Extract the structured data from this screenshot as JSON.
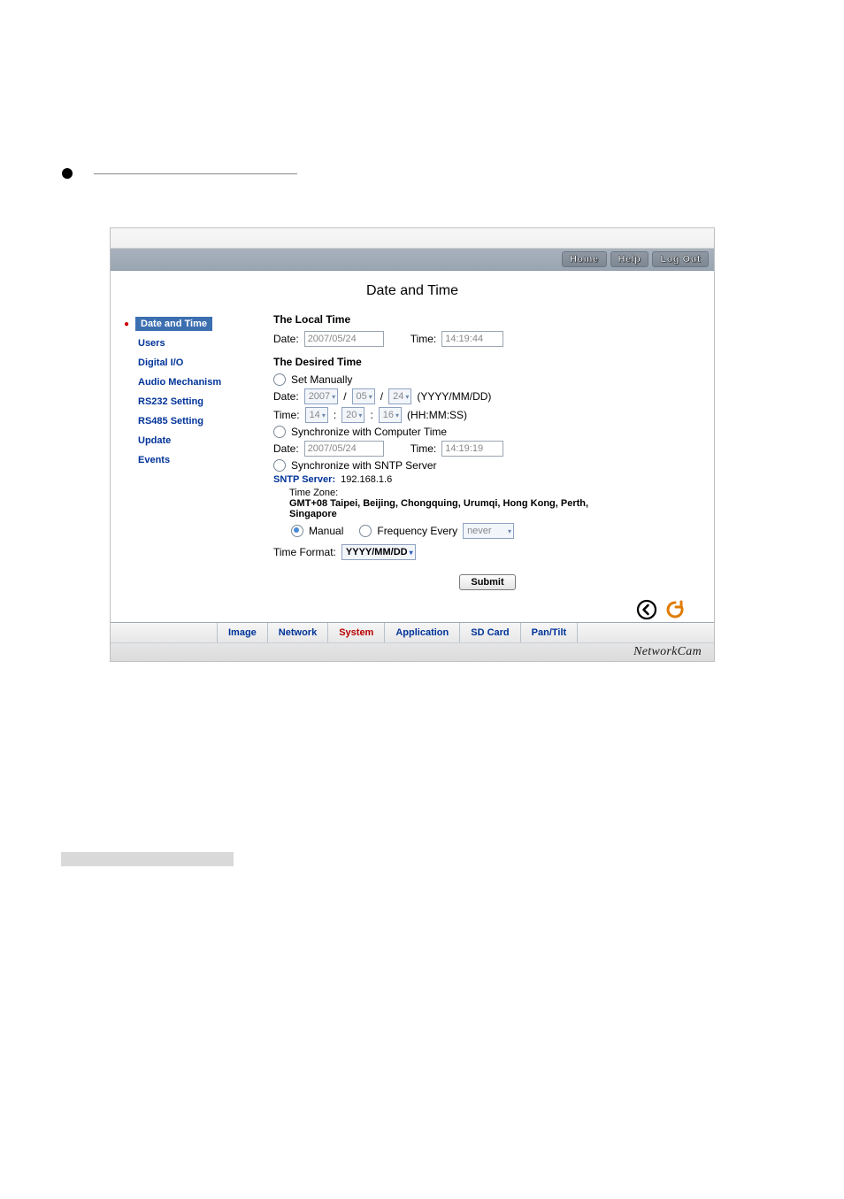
{
  "header": {
    "buttons": {
      "home": "Home",
      "help": "Help",
      "logout": "Log Out"
    }
  },
  "page": {
    "title": "Date and Time"
  },
  "sidebar": {
    "items": [
      {
        "label": "Date and Time",
        "active": true
      },
      {
        "label": "Users"
      },
      {
        "label": "Digital I/O"
      },
      {
        "label": "Audio Mechanism"
      },
      {
        "label": "RS232 Setting"
      },
      {
        "label": "RS485 Setting"
      },
      {
        "label": "Update"
      },
      {
        "label": "Events"
      }
    ]
  },
  "local_time": {
    "heading": "The Local Time",
    "date_label": "Date:",
    "date_value": "2007/05/24",
    "time_label": "Time:",
    "time_value": "14:19:44"
  },
  "desired_time": {
    "heading": "The Desired Time",
    "set_manually": "Set Manually",
    "man_date_label": "Date:",
    "man_year": "2007",
    "man_month": "05",
    "man_day": "24",
    "man_date_hint": "(YYYY/MM/DD)",
    "man_time_label": "Time:",
    "man_hh": "14",
    "man_mm": "20",
    "man_ss": "16",
    "man_time_hint": "(HH:MM:SS)",
    "sync_pc": "Synchronize with Computer Time",
    "pc_date_label": "Date:",
    "pc_date_value": "2007/05/24",
    "pc_time_label": "Time:",
    "pc_time_value": "14:19:19",
    "sync_sntp": "Synchronize with SNTP Server",
    "sntp_label": "SNTP Server:",
    "sntp_value": "192.168.1.6",
    "tz_label": "Time Zone:",
    "tz_value": "GMT+08 Taipei, Beijing, Chongquing, Urumqi, Hong Kong, Perth, Singapore",
    "mode_manual": "Manual",
    "mode_freq": "Frequency Every",
    "freq_value": "never",
    "fmt_label": "Time Format:",
    "fmt_value": "YYYY/MM/DD"
  },
  "submit": "Submit",
  "tabs": {
    "image": "Image",
    "network": "Network",
    "system": "System",
    "application": "Application",
    "sdcard": "SD Card",
    "pantilt": "Pan/Tilt"
  },
  "brand": "NetworkCam"
}
